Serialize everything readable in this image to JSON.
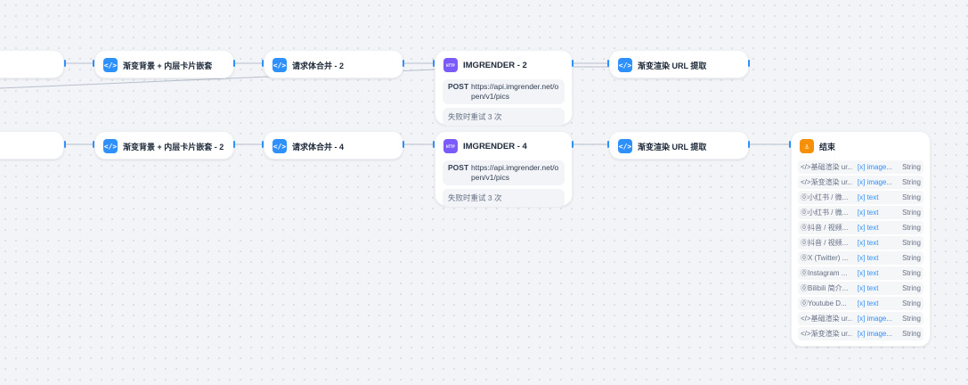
{
  "nodes": {
    "gradient_bg_1": {
      "title": "渐变背景 + 内层卡片嵌套"
    },
    "merge_2": {
      "title": "请求体合并 - 2"
    },
    "imgrender_2": {
      "title": "IMGRENDER - 2",
      "method": "POST",
      "url": "https://api.imgrender.net/open/v1/pics",
      "retry": "失败时重试 3 次"
    },
    "extract_url_1": {
      "title": "渐变渲染 URL 提取"
    },
    "gradient_bg_2": {
      "title": "渐变背景 + 内层卡片嵌套 - 2"
    },
    "merge_4": {
      "title": "请求体合并 - 4"
    },
    "imgrender_4": {
      "title": "IMGRENDER - 4",
      "method": "POST",
      "url": "https://api.imgrender.net/open/v1/pics",
      "retry": "失败时重试 3 次"
    },
    "extract_url_2": {
      "title": "渐变渲染 URL 提取"
    },
    "end": {
      "title": "结束",
      "outputs": [
        {
          "name": "</>基础渲染 ur...",
          "ref": "[x] image...",
          "type": "String"
        },
        {
          "name": "</>渐变渲染 ur...",
          "ref": "[x] image...",
          "type": "String"
        },
        {
          "name": "⓪小红书 / 微...",
          "ref": "[x] text",
          "type": "String"
        },
        {
          "name": "⓪小红书 / 微...",
          "ref": "[x] text",
          "type": "String"
        },
        {
          "name": "⓪抖音 / 视频...",
          "ref": "[x] text",
          "type": "String"
        },
        {
          "name": "⓪抖音 / 视频...",
          "ref": "[x] text",
          "type": "String"
        },
        {
          "name": "⓪X (Twitter) ...",
          "ref": "[x] text",
          "type": "String"
        },
        {
          "name": "⓪Instagram ...",
          "ref": "[x] text",
          "type": "String"
        },
        {
          "name": "⓪Bilibili 简介...",
          "ref": "[x] text",
          "type": "String"
        },
        {
          "name": "⓪Youtube D...",
          "ref": "[x] text",
          "type": "String"
        },
        {
          "name": "</>基础渲染 ur...",
          "ref": "[x] image...",
          "type": "String"
        },
        {
          "name": "</>渐变渲染 ur...",
          "ref": "[x] image...",
          "type": "String"
        }
      ]
    }
  },
  "icons": {
    "code": "</>",
    "http": "HTTP",
    "end": "⚓"
  },
  "colors": {
    "accent": "#2e90fa",
    "http": "#7a5af8",
    "end": "#f79009",
    "background": "#f2f4f7",
    "edge": "#98a2b3"
  }
}
